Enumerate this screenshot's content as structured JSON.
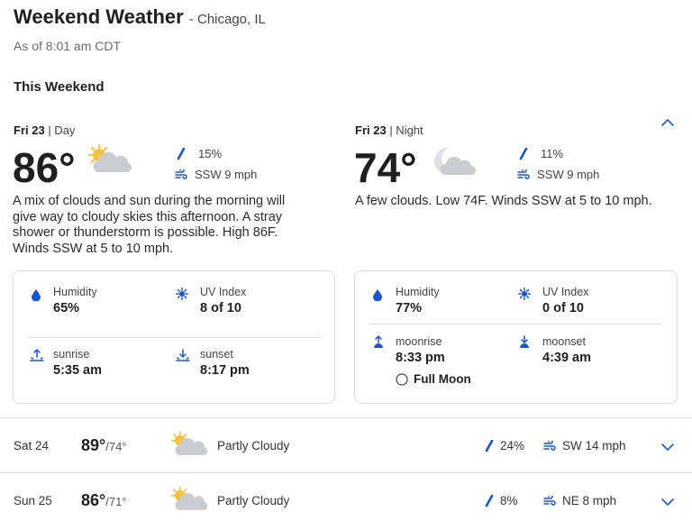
{
  "header": {
    "title": "Weekend Weather",
    "location": "- Chicago, IL",
    "as_of": "As of 8:01 am CDT",
    "section": "This Weekend"
  },
  "day": {
    "date": "Fri 23",
    "period": "| Day",
    "temp": "86°",
    "precip": "15%",
    "wind": "SSW 9 mph",
    "desc": "A mix of clouds and sun during the morning will give way to cloudy skies this afternoon. A stray shower or thunderstorm is possible. High 86F. Winds SSW at 5 to 10 mph.",
    "humidity_label": "Humidity",
    "humidity": "65%",
    "uv_label": "UV Index",
    "uv": "8 of 10",
    "sunrise_label": "sunrise",
    "sunrise": "5:35 am",
    "sunset_label": "sunset",
    "sunset": "8:17 pm"
  },
  "night": {
    "date": "Fri 23",
    "period": "| Night",
    "temp": "74°",
    "precip": "11%",
    "wind": "SSW 9 mph",
    "desc": "A few clouds. Low 74F. Winds SSW at 5 to 10 mph.",
    "humidity_label": "Humidity",
    "humidity": "77%",
    "uv_label": "UV Index",
    "uv": "0 of 10",
    "moonrise_label": "moonrise",
    "moonrise": "8:33 pm",
    "moonset_label": "moonset",
    "moonset": "4:39 am",
    "moon_phase": "Full Moon"
  },
  "rows": [
    {
      "day": "Sat 24",
      "hi": "89°",
      "lo": "/74°",
      "cond": "Partly Cloudy",
      "precip": "24%",
      "wind": "SW 14 mph"
    },
    {
      "day": "Sun 25",
      "hi": "86°",
      "lo": "/71°",
      "cond": "Partly Cloudy",
      "precip": "8%",
      "wind": "NE 8 mph"
    }
  ],
  "colors": {
    "accent": "#1a56c9",
    "sun": "#f5c343",
    "cloud": "#c9ccd1"
  }
}
